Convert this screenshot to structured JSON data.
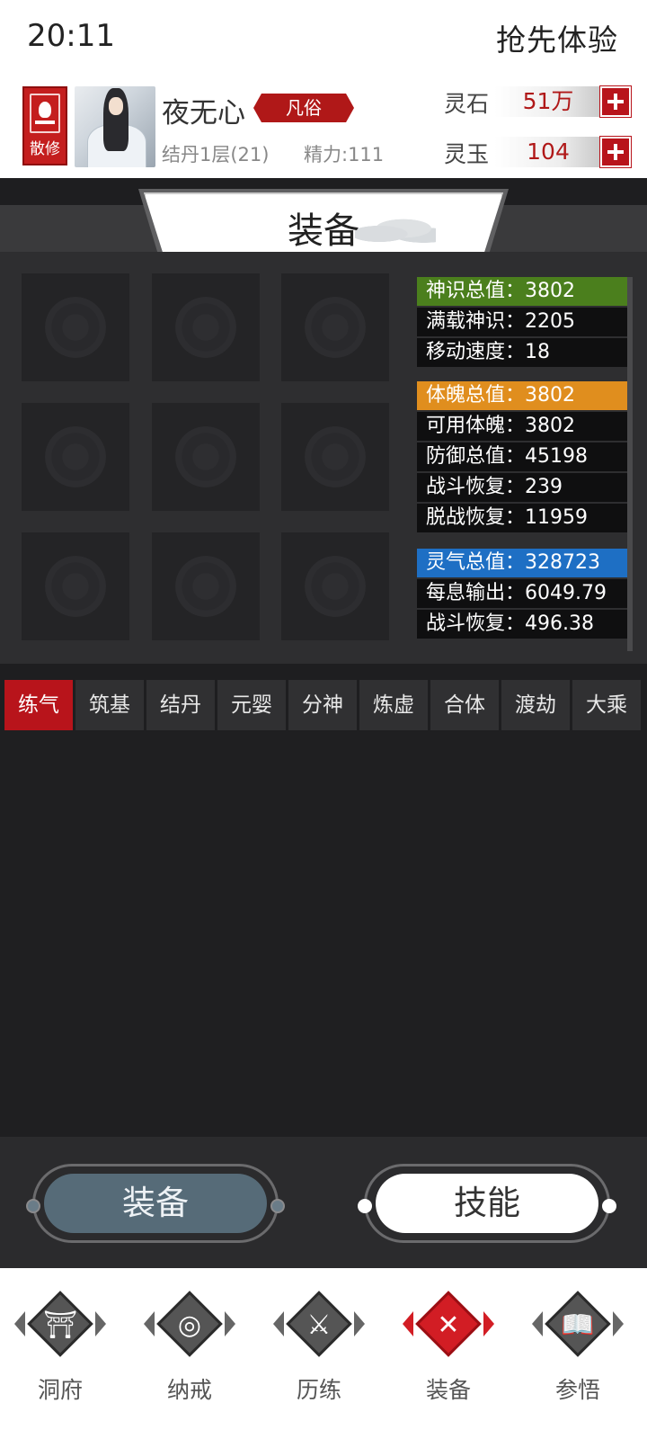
{
  "status_bar": {
    "time": "20:11",
    "right_text": "抢先体验"
  },
  "profile": {
    "sect_label": "散修",
    "name": "夜无心",
    "rank": "凡俗",
    "realm": "结丹1层(21)",
    "energy": "精力:111",
    "currencies": [
      {
        "label": "灵石",
        "value": "51万"
      },
      {
        "label": "灵玉",
        "value": "104"
      }
    ]
  },
  "panel_title": "装备",
  "stats": {
    "groups": [
      {
        "head": "神识总值：3802",
        "color": "#4b7f1d",
        "rows": [
          "满载神识：2205",
          "移动速度：18"
        ]
      },
      {
        "head": "体魄总值：3802",
        "color": "#e08e1e",
        "rows": [
          "可用体魄：3802",
          "防御总值：45198",
          "战斗恢复：239",
          "脱战恢复：11959"
        ]
      },
      {
        "head": "灵气总值：328723",
        "color": "#1e6fc4",
        "rows": [
          "每息输出：6049.79",
          "战斗恢复：496.38"
        ]
      }
    ]
  },
  "realm_tabs": [
    "练气",
    "筑基",
    "结丹",
    "元婴",
    "分神",
    "炼虚",
    "合体",
    "渡劫",
    "大乘"
  ],
  "active_realm_tab": "练气",
  "toggle": {
    "left": "装备",
    "right": "技能"
  },
  "bottom_nav": [
    {
      "label": "洞府",
      "icon": "gate-icon"
    },
    {
      "label": "纳戒",
      "icon": "ring-icon"
    },
    {
      "label": "历练",
      "icon": "crossed-swords-icon"
    },
    {
      "label": "装备",
      "icon": "equipment-icon"
    },
    {
      "label": "参悟",
      "icon": "book-icon"
    }
  ],
  "active_nav": "装备"
}
